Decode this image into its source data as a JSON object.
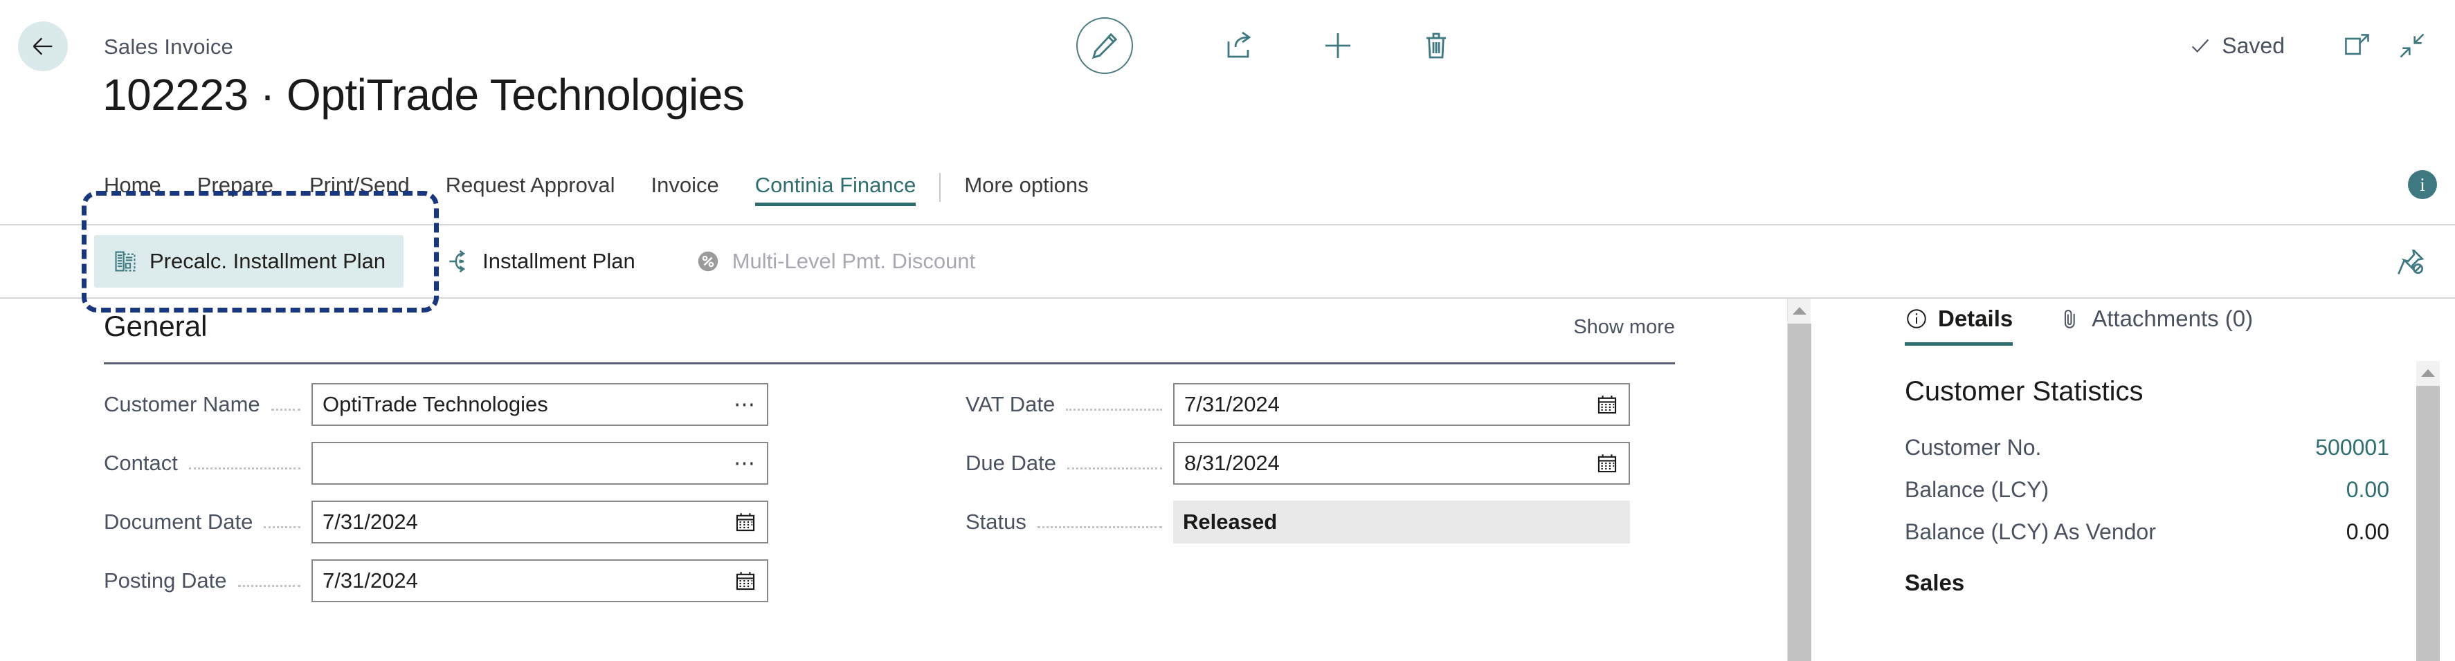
{
  "header": {
    "back_icon": "arrow-left-icon",
    "breadcrumb": "Sales Invoice",
    "title": "102223 · OptiTrade Technologies",
    "center_actions": [
      {
        "name": "edit-button",
        "icon": "pencil-icon",
        "label": "Edit"
      },
      {
        "name": "share-button",
        "icon": "share-icon",
        "label": "Share"
      },
      {
        "name": "new-button",
        "icon": "plus-icon",
        "label": "New"
      },
      {
        "name": "delete-button",
        "icon": "trash-icon",
        "label": "Delete"
      }
    ],
    "saved_label": "Saved",
    "saved_icon": "checkmark-icon",
    "open_new_window_icon": "open-in-new-window-icon",
    "collapse_icon": "collapse-arrows-icon"
  },
  "tabs": {
    "items": [
      {
        "label": "Home",
        "active": false
      },
      {
        "label": "Prepare",
        "active": false
      },
      {
        "label": "Print/Send",
        "active": false
      },
      {
        "label": "Request Approval",
        "active": false
      },
      {
        "label": "Invoice",
        "active": false
      },
      {
        "label": "Continia Finance",
        "active": true
      }
    ],
    "more_options": "More options",
    "info_badge": "i"
  },
  "ribbon": {
    "actions": [
      {
        "label": "Precalc. Installment Plan",
        "icon": "document-list-icon",
        "selected": true,
        "disabled": false
      },
      {
        "label": "Installment Plan",
        "icon": "split-arrows-icon",
        "selected": false,
        "disabled": false
      },
      {
        "label": "Multi-Level Pmt. Discount",
        "icon": "percent-circle-icon",
        "selected": false,
        "disabled": true
      }
    ],
    "pin_icon": "unpin-icon"
  },
  "general": {
    "title": "General",
    "show_more": "Show more",
    "left_fields": [
      {
        "label": "Customer Name",
        "value": "OptiTrade Technologies",
        "placeholder": "",
        "control": "lookup"
      },
      {
        "label": "Contact",
        "value": "",
        "placeholder": "",
        "control": "lookup"
      },
      {
        "label": "Document Date",
        "value": "7/31/2024",
        "placeholder": "",
        "control": "date"
      },
      {
        "label": "Posting Date",
        "value": "7/31/2024",
        "placeholder": "",
        "control": "date"
      }
    ],
    "right_fields": [
      {
        "label": "VAT Date",
        "value": "7/31/2024",
        "placeholder": "",
        "control": "date"
      },
      {
        "label": "Due Date",
        "value": "8/31/2024",
        "placeholder": "",
        "control": "date"
      },
      {
        "label": "Status",
        "value": "Released",
        "placeholder": "",
        "control": "readonly"
      }
    ]
  },
  "fact_panel": {
    "tabs": [
      {
        "label": "Details",
        "icon": "info-circle-icon",
        "active": true
      },
      {
        "label": "Attachments (0)",
        "icon": "paperclip-icon",
        "active": false
      }
    ],
    "customer_statistics_title": "Customer Statistics",
    "stats": [
      {
        "label": "Customer No.",
        "value": "500001",
        "accent": true
      },
      {
        "label": "Balance (LCY)",
        "value": "0.00",
        "accent": true
      },
      {
        "label": "Balance (LCY) As Vendor",
        "value": "0.00",
        "accent": false
      }
    ],
    "sales_title": "Sales"
  },
  "colors": {
    "accent_teal": "#2e6e70",
    "pale_teal": "#daeaea",
    "selected_action_bg": "#dcebeb",
    "highlight_dashed": "#18377f",
    "label_grey": "#4a5160",
    "status_bg": "#e9e9e9"
  }
}
